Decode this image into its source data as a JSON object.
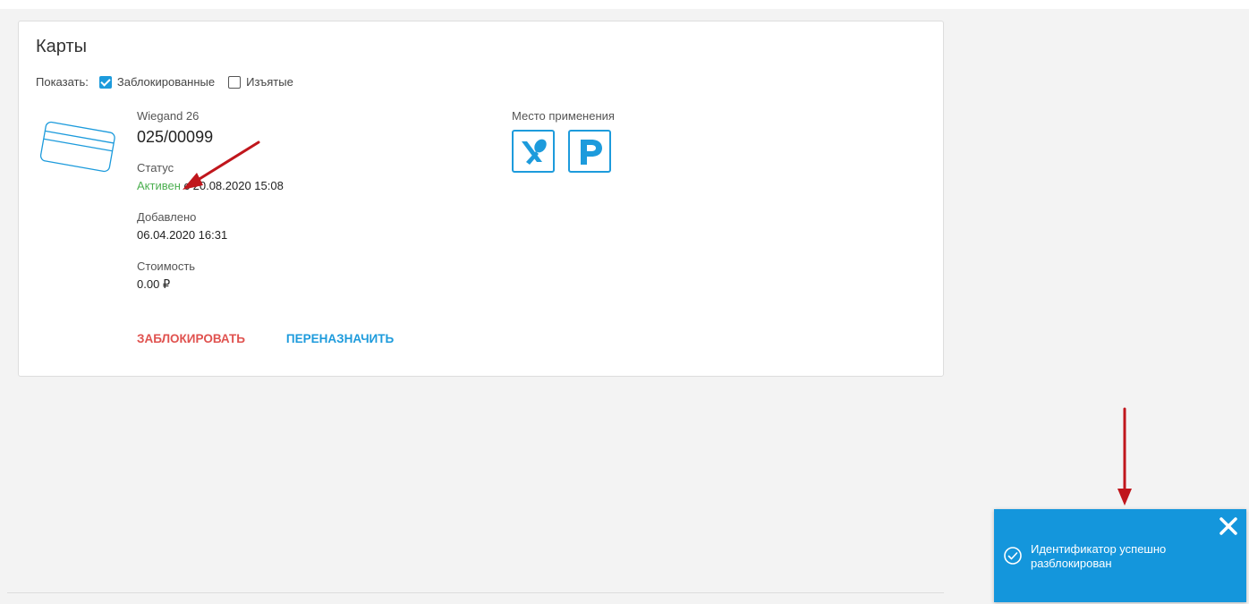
{
  "card_section": {
    "title": "Карты",
    "filter": {
      "label": "Показать:",
      "options": [
        {
          "label": "Заблокированные",
          "checked": true
        },
        {
          "label": "Изъятые",
          "checked": false
        }
      ]
    },
    "card": {
      "type": "Wiegand 26",
      "number": "025/00099",
      "status_label": "Статус",
      "status_value": "Активен",
      "status_since": "с 20.08.2020 15:08",
      "added_label": "Добавлено",
      "added_value": "06.04.2020 16:31",
      "cost_label": "Стоимость",
      "cost_value": "0.00 ₽"
    },
    "usage": {
      "label": "Место применения",
      "icons": [
        "restaurant-icon",
        "parking-icon"
      ]
    },
    "actions": {
      "block_label": "ЗАБЛОКИРОВАТЬ",
      "reassign_label": "ПЕРЕНАЗНАЧИТЬ"
    }
  },
  "toast": {
    "message": "Идентификатор успешно разблокирован",
    "icon": "check-circle-icon",
    "close_icon": "close-icon"
  },
  "colors": {
    "accent": "#1d9bdc",
    "toast_bg": "#1496dc",
    "status_active": "#4caf50",
    "danger": "#e0524f",
    "annotation_arrow": "#c0161c"
  }
}
